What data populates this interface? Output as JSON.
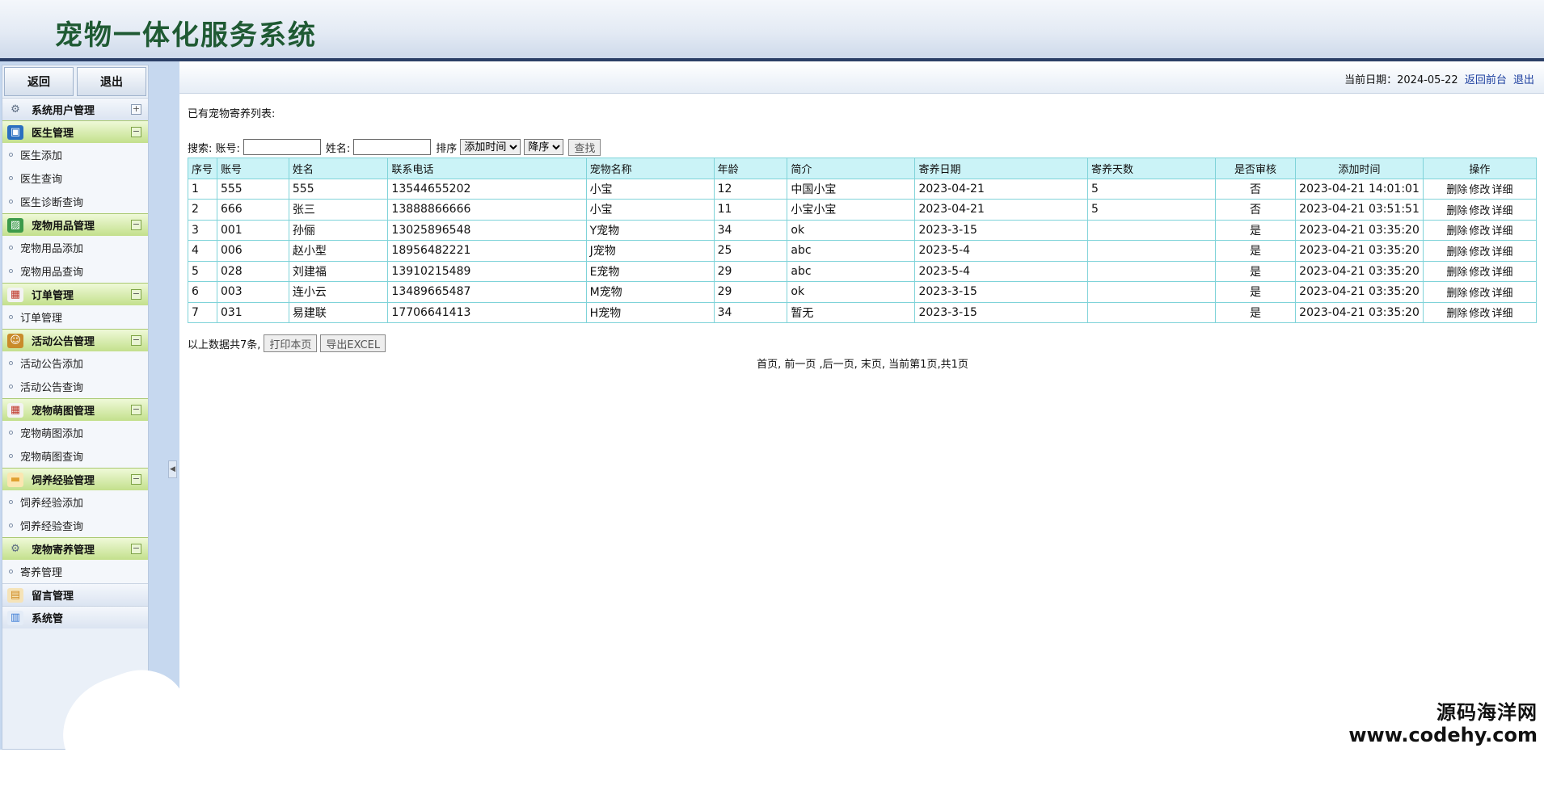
{
  "app": {
    "title": "宠物一体化服务系统"
  },
  "sidebar": {
    "back_label": "返回",
    "logout_label": "退出",
    "groups": [
      {
        "label": "系统用户管理",
        "icon": "gear-icon",
        "items": []
      },
      {
        "label": "医生管理",
        "icon": "monitor-icon",
        "items": [
          "医生添加",
          "医生查询",
          "医生诊断查询"
        ]
      },
      {
        "label": "宠物用品管理",
        "icon": "image-icon",
        "items": [
          "宠物用品添加",
          "宠物用品查询"
        ]
      },
      {
        "label": "订单管理",
        "icon": "calendar-icon",
        "items": [
          "订单管理"
        ]
      },
      {
        "label": "活动公告管理",
        "icon": "user-icon",
        "items": [
          "活动公告添加",
          "活动公告查询"
        ]
      },
      {
        "label": "宠物萌图管理",
        "icon": "calendar-icon",
        "items": [
          "宠物萌图添加",
          "宠物萌图查询"
        ]
      },
      {
        "label": "饲养经验管理",
        "icon": "folder-icon",
        "items": [
          "饲养经验添加",
          "饲养经验查询"
        ]
      },
      {
        "label": "宠物寄养管理",
        "icon": "gear-icon",
        "items": [
          "寄养管理"
        ]
      },
      {
        "label": "留言管理",
        "icon": "lock-icon",
        "items": []
      },
      {
        "label": "系统管",
        "icon": "chart-icon",
        "items": []
      }
    ]
  },
  "topbar": {
    "date_label": "当前日期：",
    "date_value": "2024-05-22",
    "front_link": "返回前台",
    "logout_link": "退出"
  },
  "main": {
    "list_title": "已有宠物寄养列表:",
    "search": {
      "label": "搜索: 账号:",
      "account_value": "",
      "name_label": "姓名:",
      "name_value": "",
      "sort_label": "排序",
      "sort_field": "添加时间",
      "sort_order": "降序",
      "search_button": "查找"
    },
    "columns": [
      "序号",
      "账号",
      "姓名",
      "联系电话",
      "宠物名称",
      "年龄",
      "简介",
      "寄养日期",
      "寄养天数",
      "是否审核",
      "添加时间",
      "操作"
    ],
    "rows": [
      [
        "1",
        "555",
        "555",
        "13544655202",
        "小宝",
        "12",
        "中国小宝",
        "2023-04-21",
        "5",
        "否",
        "2023-04-21 14:01:01"
      ],
      [
        "2",
        "666",
        "张三",
        "13888866666",
        "小宝",
        "11",
        "小宝小宝",
        "2023-04-21",
        "5",
        "否",
        "2023-04-21 03:51:51"
      ],
      [
        "3",
        "001",
        "孙俪",
        "13025896548",
        "Y宠物",
        "34",
        "ok",
        "2023-3-15",
        "",
        "是",
        "2023-04-21 03:35:20"
      ],
      [
        "4",
        "006",
        "赵小型",
        "18956482221",
        "J宠物",
        "25",
        "abc",
        "2023-5-4",
        "",
        "是",
        "2023-04-21 03:35:20"
      ],
      [
        "5",
        "028",
        "刘建福",
        "13910215489",
        "E宠物",
        "29",
        "abc",
        "2023-5-4",
        "",
        "是",
        "2023-04-21 03:35:20"
      ],
      [
        "6",
        "003",
        "连小云",
        "13489665487",
        "M宠物",
        "29",
        "ok",
        "2023-3-15",
        "",
        "是",
        "2023-04-21 03:35:20"
      ],
      [
        "7",
        "031",
        "易建联",
        "17706641413",
        "H宠物",
        "34",
        "暂无",
        "2023-3-15",
        "",
        "是",
        "2023-04-21 03:35:20"
      ]
    ],
    "ops": {
      "delete": "删除",
      "edit": "修改",
      "detail": "详细"
    },
    "total_text": "以上数据共7条,",
    "print_button": "打印本页",
    "export_button": "导出EXCEL",
    "pager": "首页, 前一页 ,后一页, 末页, 当前第1页,共1页"
  },
  "watermark": {
    "line1": "源码海洋网",
    "line2": "www.codehy.com"
  }
}
